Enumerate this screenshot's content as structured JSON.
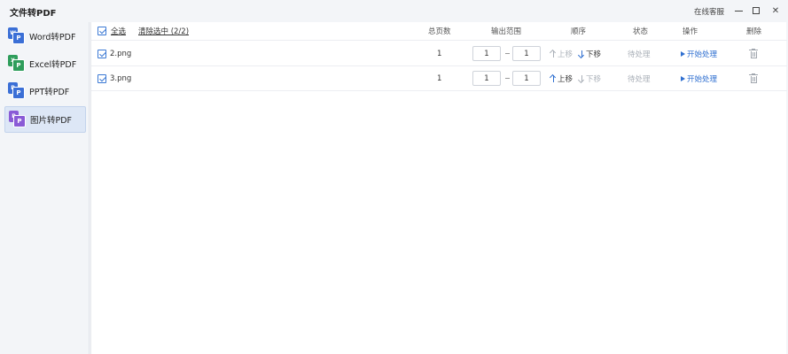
{
  "window": {
    "title": "文件转PDF",
    "support_label": "在线客服",
    "close_glyph": "✕"
  },
  "sidebar": {
    "items": [
      {
        "label": "Word转PDF",
        "icon": "word-icon",
        "color": "#3b6fd6",
        "badge": "W",
        "active": false
      },
      {
        "label": "Excel转PDF",
        "icon": "excel-icon",
        "color": "#2e9d5b",
        "badge": "X",
        "active": false
      },
      {
        "label": "PPT转PDF",
        "icon": "ppt-icon",
        "color": "#3b6fd6",
        "badge": "P",
        "active": false
      },
      {
        "label": "图片转PDF",
        "icon": "image-icon",
        "color": "#8a5bd6",
        "badge": "P",
        "active": true
      }
    ],
    "pdf_badge": "P"
  },
  "table": {
    "select_all_label": "全选",
    "clear_selection_label": "清除选中 (2/2)",
    "columns": {
      "pages": "总页数",
      "range": "输出范围",
      "order": "顺序",
      "status": "状态",
      "action": "操作",
      "delete": "删除"
    },
    "rows": [
      {
        "name": "2.png",
        "pages": "1",
        "range_from": "1",
        "range_to": "1",
        "move_up": "上移",
        "move_down": "下移",
        "up_enabled": false,
        "down_enabled": true,
        "status": "待处理",
        "action": "开始处理"
      },
      {
        "name": "3.png",
        "pages": "1",
        "range_from": "1",
        "range_to": "1",
        "move_up": "上移",
        "move_down": "下移",
        "up_enabled": true,
        "down_enabled": false,
        "status": "待处理",
        "action": "开始处理"
      }
    ]
  },
  "colors": {
    "accent": "#2f6fd0",
    "disabled": "#aab0b8",
    "active_sidebar_bg": "#dde7f6"
  }
}
